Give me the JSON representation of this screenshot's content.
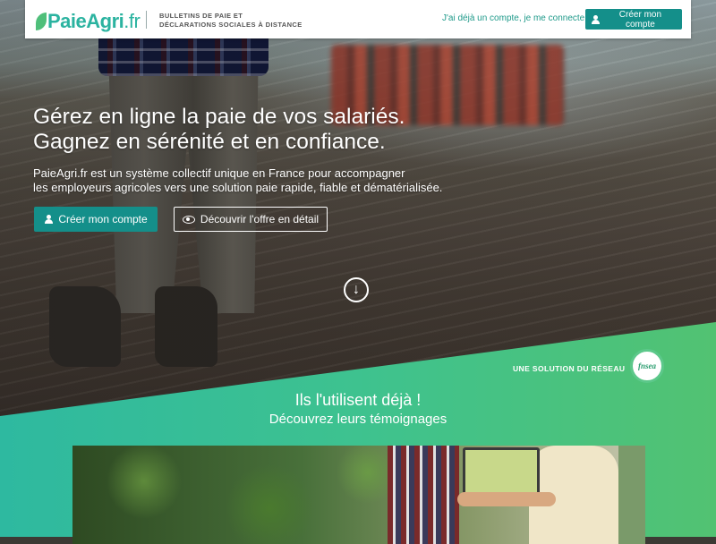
{
  "header": {
    "logo": {
      "part1": "Paie",
      "part2": "Agri",
      "part3": ".fr"
    },
    "tagline_line1": "BULLETINS DE PAIE ET",
    "tagline_line2": "DÉCLARATIONS SOCIALES À DISTANCE",
    "login_link": "J'ai déjà un compte, je me connecte",
    "create_account": "Créer mon compte"
  },
  "hero": {
    "headline_line1": "Gérez en ligne la paie de vos salariés.",
    "headline_line2": "Gagnez en sérénité et en confiance.",
    "lead_line1": "PaieAgri.fr est un système collectif unique en France pour accompagner",
    "lead_line2": "les employeurs agricoles vers une solution paie rapide, fiable et dématérialisée.",
    "cta_primary": "Créer mon compte",
    "cta_secondary": "Découvrir l'offre en détail",
    "scroll_symbol": "↓"
  },
  "network": {
    "label": "UNE SOLUTION DU RÉSEAU",
    "logo_text": "fnsea"
  },
  "testimonials": {
    "title": "Ils l'utilisent déjà !",
    "subtitle": "Découvrez leurs témoignages"
  },
  "colors": {
    "brand_teal": "#148f8a",
    "logo_teal": "#2bb3a0",
    "band_start": "#2eb9a0",
    "band_end": "#52c272"
  }
}
